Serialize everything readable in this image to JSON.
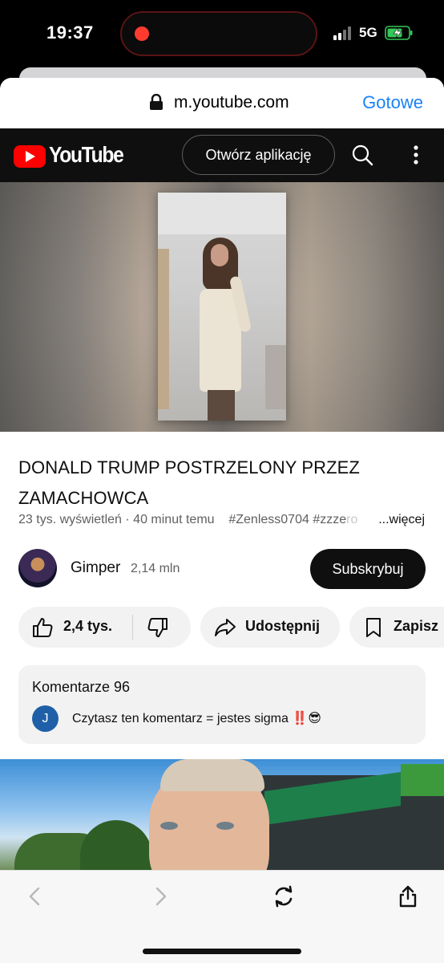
{
  "status_bar": {
    "time": "19:37",
    "network": "5G",
    "recording_color": "#ff3b30",
    "battery_color": "#34c759"
  },
  "browser": {
    "url": "m.youtube.com",
    "done_label": "Gotowe",
    "accent": "#1a82f7",
    "back_icon": "chevron-left-icon",
    "forward_icon": "chevron-right-icon",
    "reload_icon": "reload-icon",
    "share_icon": "share-icon"
  },
  "youtube_header": {
    "logo_text": "YouTube",
    "open_app_label": "Otwórz aplikację",
    "brand_color": "#ff0000"
  },
  "video": {
    "title": "DONALD TRUMP POSTRZELONY PRZEZ ZAMACHOWCA",
    "views": "23 tys. wyświetleń",
    "age": "40 minut temu",
    "tags": "#Zenless0704 #zzze",
    "tags_faded": "ro",
    "more_label": "...więcej"
  },
  "channel": {
    "name": "Gimper",
    "subscribers": "2,14 mln",
    "subscribe_label": "Subskrybuj"
  },
  "actions": {
    "likes": "2,4 tys.",
    "share_label": "Udostępnij",
    "save_label": "Zapisz"
  },
  "comments": {
    "header": "Komentarze 96",
    "author_initial": "J",
    "text": "Czytasz ten komentarz = jestes sigma",
    "emoji_bang": "‼️",
    "emoji_face": "😎"
  }
}
